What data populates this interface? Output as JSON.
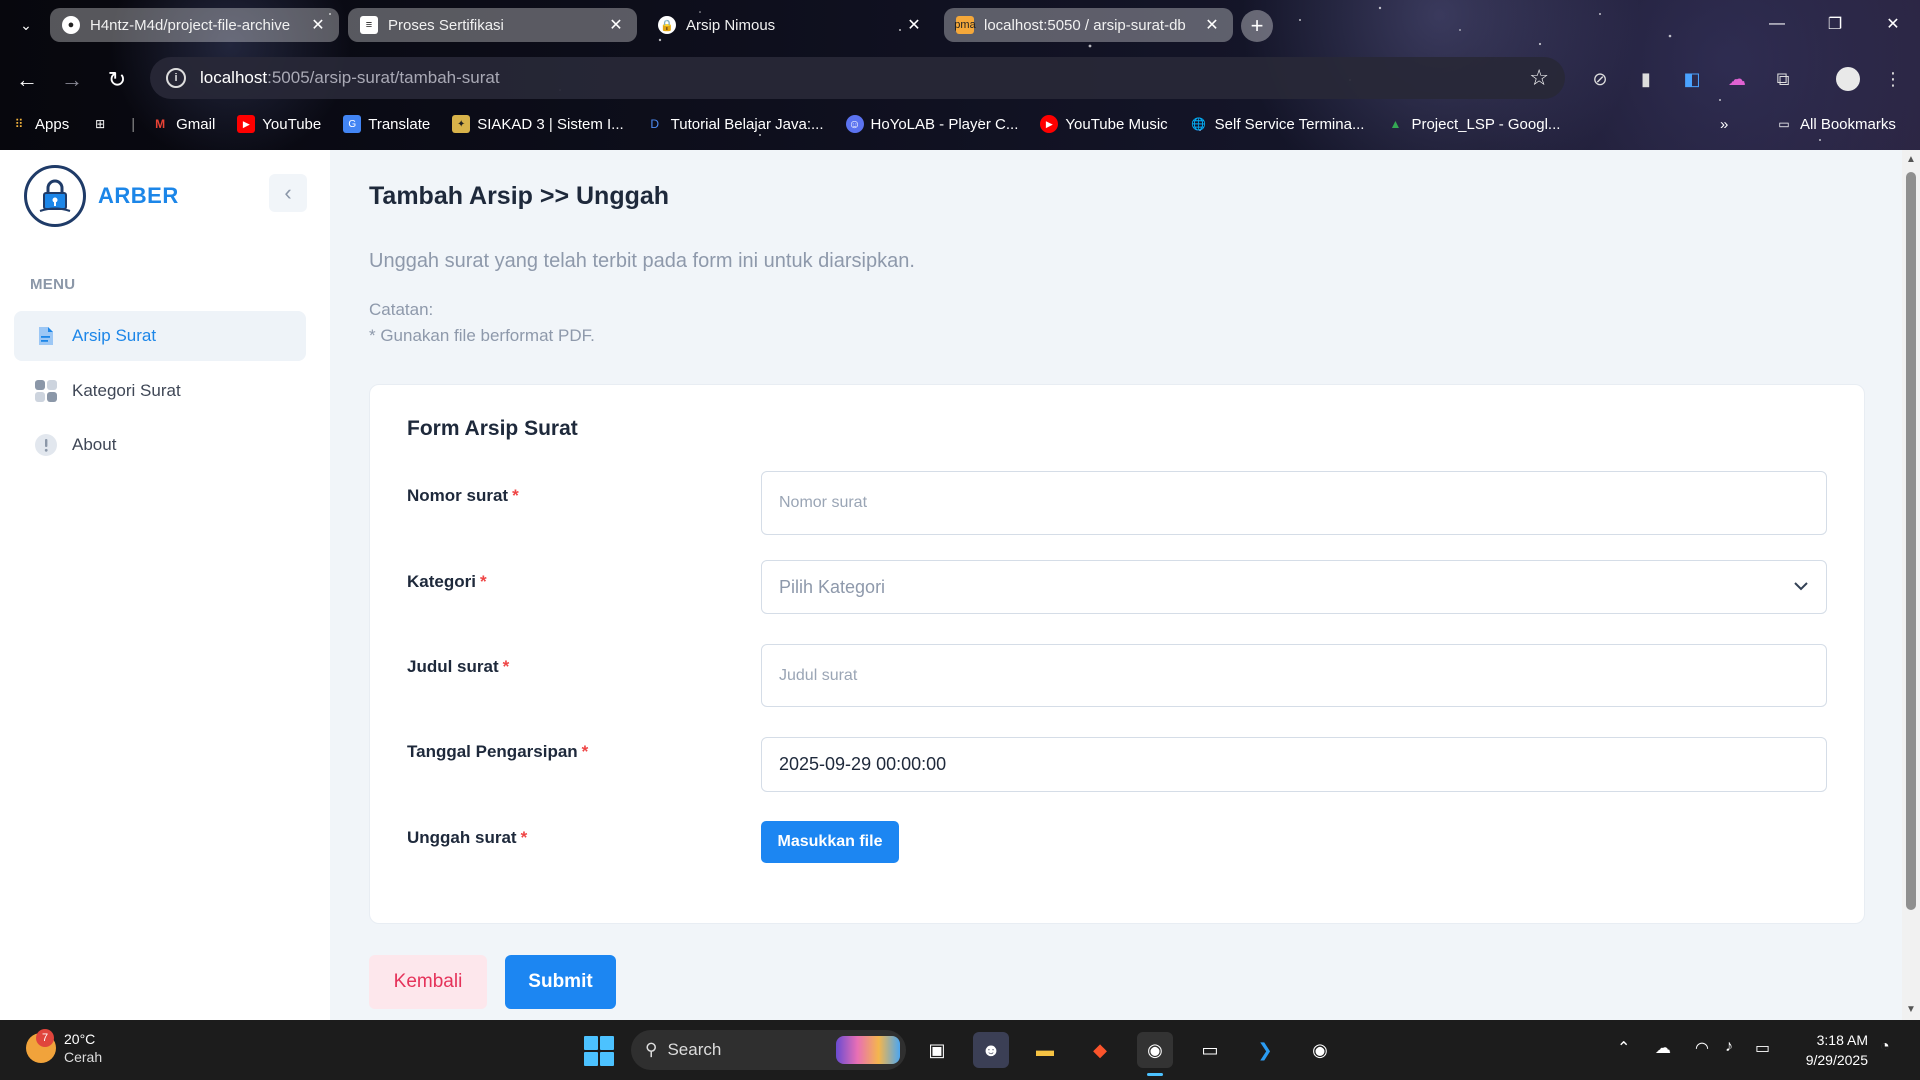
{
  "browser": {
    "tabs": [
      {
        "title": "H4ntz-M4d/project-file-archive",
        "favicon": "github-icon"
      },
      {
        "title": "Proses Sertifikasi",
        "favicon": "form-icon"
      },
      {
        "title": "Arsip Nimous",
        "favicon": "lock-icon"
      },
      {
        "title": "localhost:5050 / arsip-surat-db",
        "favicon": "phpmyadmin-icon"
      }
    ],
    "url_host": "localhost",
    "url_path": ":5005/arsip-surat/tambah-surat",
    "bookmarks": [
      {
        "label": "Apps",
        "icon": "apps-grid-icon"
      },
      {
        "label": "",
        "icon": "dashboard-icon"
      },
      {
        "label": "Gmail",
        "icon": "gmail-icon"
      },
      {
        "label": "YouTube",
        "icon": "youtube-icon"
      },
      {
        "label": "Translate",
        "icon": "translate-icon"
      },
      {
        "label": "SIAKAD 3 | Sistem I...",
        "icon": "siakad-icon"
      },
      {
        "label": "Tutorial Belajar Java:...",
        "icon": "d-icon"
      },
      {
        "label": "HoYoLAB - Player C...",
        "icon": "hoyolab-icon"
      },
      {
        "label": "YouTube Music",
        "icon": "youtube-music-icon"
      },
      {
        "label": "Self Service Termina...",
        "icon": "globe-icon"
      },
      {
        "label": "Project_LSP - Googl...",
        "icon": "google-drive-icon"
      }
    ],
    "all_bookmarks": "All Bookmarks"
  },
  "app": {
    "brand": "ARBER",
    "menu_heading": "MENU",
    "nav": [
      {
        "label": "Arsip Surat",
        "icon": "document-icon",
        "active": true
      },
      {
        "label": "Kategori Surat",
        "icon": "grid-icon",
        "active": false
      },
      {
        "label": "About",
        "icon": "info-icon",
        "active": false
      }
    ]
  },
  "main": {
    "title": "Tambah Arsip >> Unggah",
    "description": "Unggah surat yang telah terbit pada form ini untuk diarsipkan.",
    "note_label": "Catatan:",
    "note_text": "* Gunakan file berformat PDF.",
    "form": {
      "title": "Form Arsip Surat",
      "fields": {
        "nomor": {
          "label": "Nomor surat",
          "placeholder": "Nomor surat",
          "value": ""
        },
        "kategori": {
          "label": "Kategori",
          "selected": "Pilih Kategori"
        },
        "judul": {
          "label": "Judul surat",
          "placeholder": "Judul surat",
          "value": ""
        },
        "tanggal": {
          "label": "Tanggal Pengarsipan",
          "value": "2025-09-29 00:00:00"
        },
        "unggah": {
          "label": "Unggah surat",
          "button": "Masukkan file"
        }
      },
      "required_mark": "*"
    },
    "buttons": {
      "back": "Kembali",
      "submit": "Submit"
    }
  },
  "taskbar": {
    "weather_temp": "20°C",
    "weather_cond": "Cerah",
    "weather_badge": "7",
    "search_label": "Search",
    "time": "3:18 AM",
    "date": "9/29/2025"
  },
  "colors": {
    "accent": "#1c86f2",
    "brand": "#1c86e8",
    "danger": "#ef4444",
    "back_bg": "#fde7ec",
    "back_text": "#e5335a"
  }
}
